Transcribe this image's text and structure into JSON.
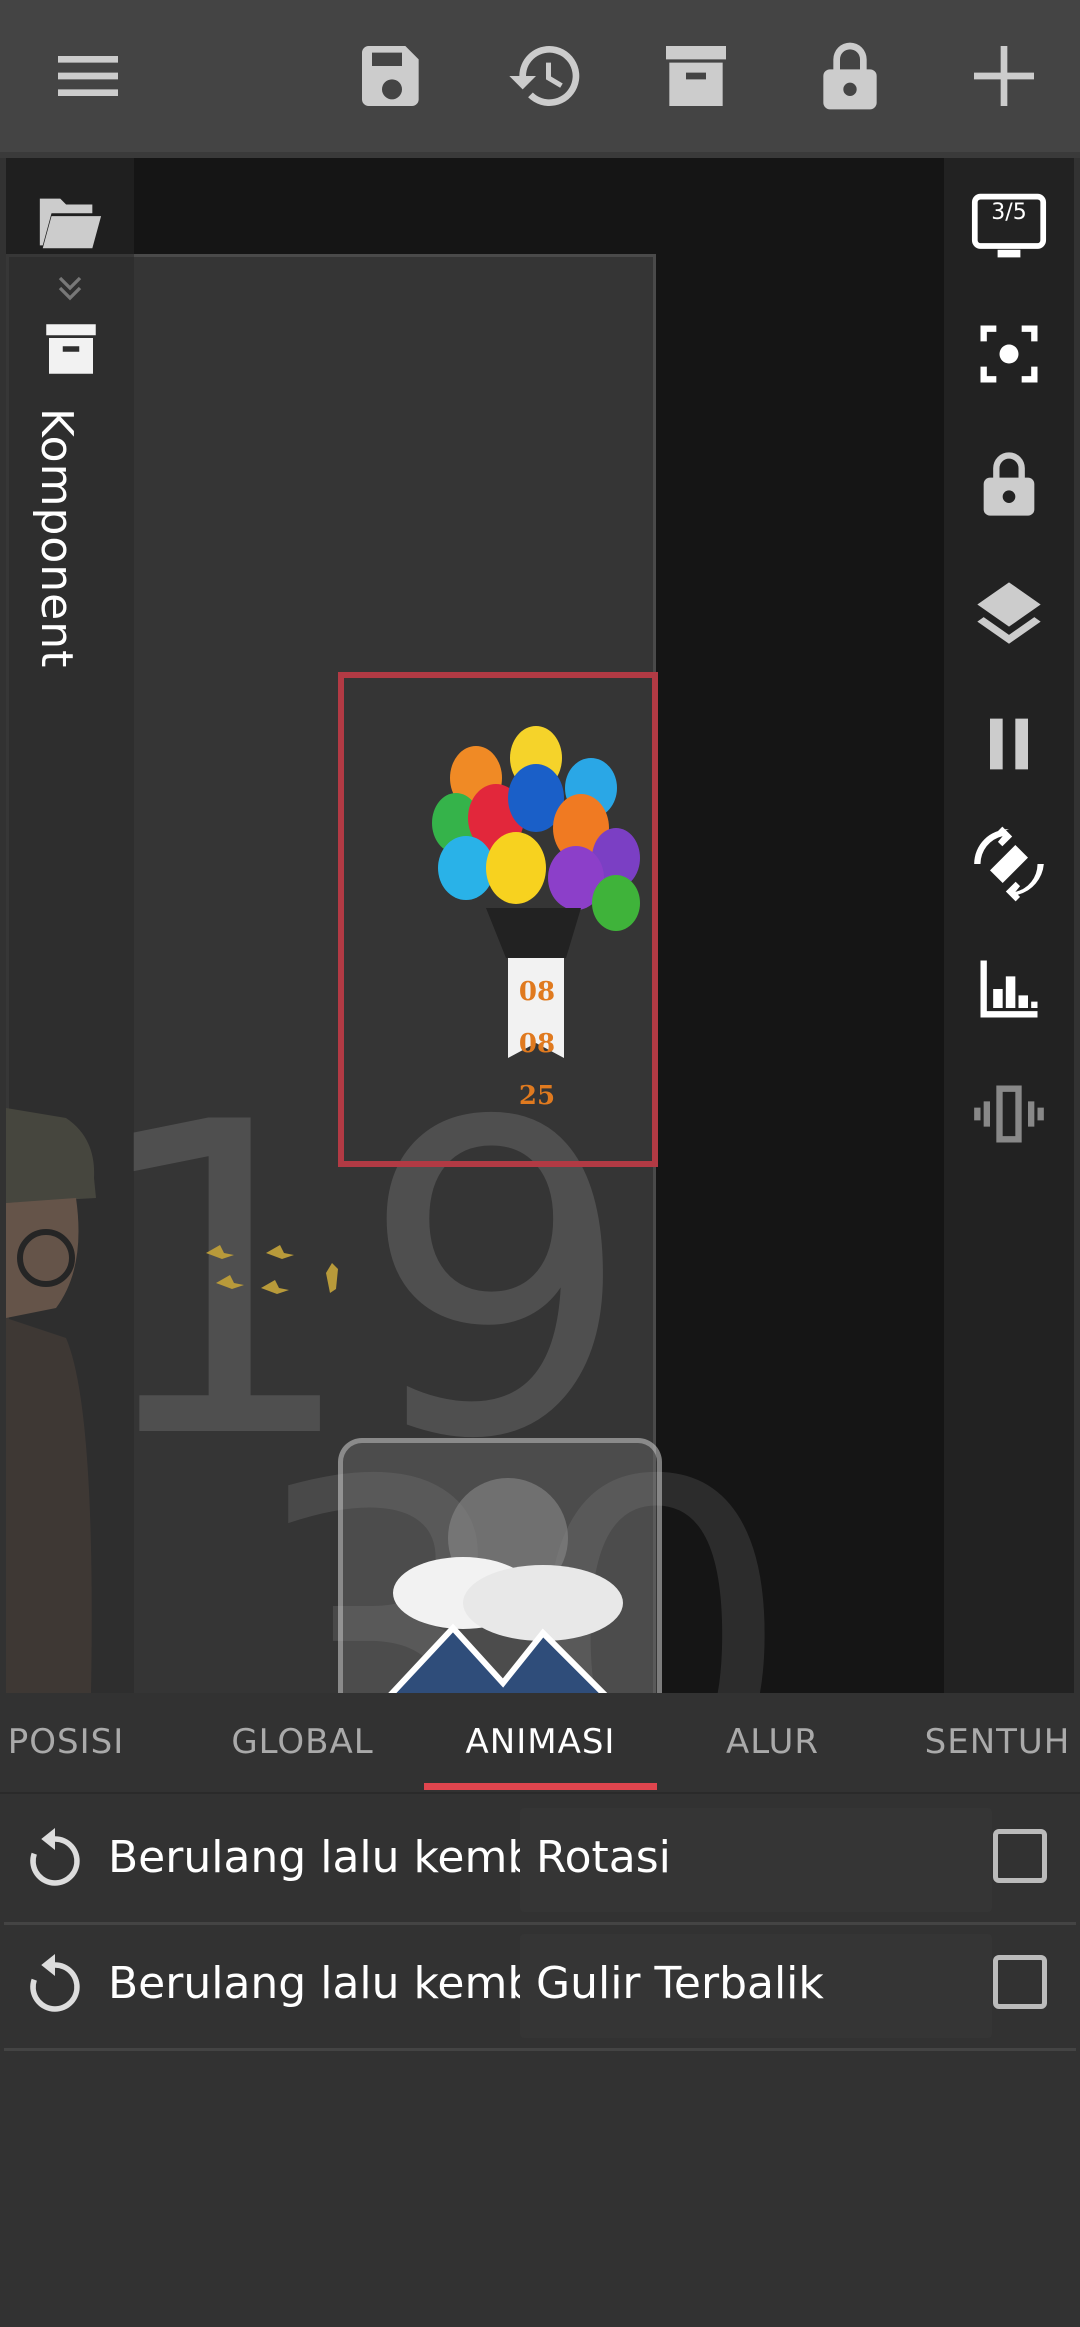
{
  "toolbar": {
    "icons": [
      "menu-icon",
      "save-icon",
      "history-icon",
      "archive-icon",
      "lock-icon",
      "add-icon"
    ]
  },
  "preview": {
    "side_panel_label": "Komponent",
    "rail_badge": "3/5",
    "clock_hour": "19",
    "clock_minute": "30",
    "ribbon_lines": [
      "08",
      "08",
      "25"
    ]
  },
  "tabs": [
    {
      "label": "POSISI",
      "active": false
    },
    {
      "label": "GLOBAL",
      "active": false
    },
    {
      "label": "ANIMASI",
      "active": true
    },
    {
      "label": "ALUR",
      "active": false
    },
    {
      "label": "SENTUH",
      "active": false
    }
  ],
  "animations": [
    {
      "mode": "Berulang lalu kemb..",
      "type": "Rotasi",
      "checked": false
    },
    {
      "mode": "Berulang lalu kemb..",
      "type": "Gulir Terbalik",
      "checked": false
    }
  ],
  "colors": {
    "accent": "#e0454e",
    "toolbar": "#444444",
    "background": "#323232"
  }
}
